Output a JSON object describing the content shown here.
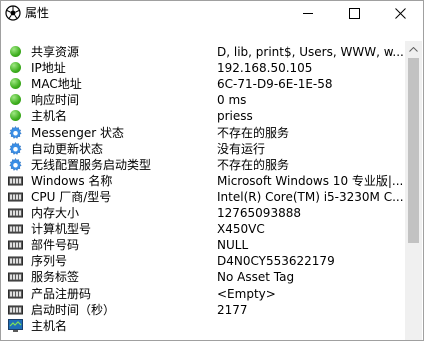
{
  "window": {
    "title": "属性"
  },
  "rows": [
    {
      "label": "共享资源",
      "value": "D, lib, print$, Users, WWW, w...",
      "icon": "green-dot-icon"
    },
    {
      "label": "IP地址",
      "value": "192.168.50.105",
      "icon": "green-dot-icon"
    },
    {
      "label": "MAC地址",
      "value": "6C-71-D9-6E-1E-58",
      "icon": "green-dot-icon"
    },
    {
      "label": "响应时间",
      "value": "0 ms",
      "icon": "green-dot-icon"
    },
    {
      "label": "主机名",
      "value": "priess",
      "icon": "green-dot-icon"
    },
    {
      "label": "Messenger 状态",
      "value": "不存在的服务",
      "icon": "gear-icon"
    },
    {
      "label": "自动更新状态",
      "value": "没有运行",
      "icon": "gear-icon"
    },
    {
      "label": "无线配置服务启动类型",
      "value": "不存在的服务",
      "icon": "gear-icon"
    },
    {
      "label": "Windows 名称",
      "value": "Microsoft Windows 10 专业版|...",
      "icon": "memory-chip-icon"
    },
    {
      "label": "CPU 厂商/型号",
      "value": "Intel(R) Core(TM) i5-3230M C...",
      "icon": "memory-chip-icon"
    },
    {
      "label": "内存大小",
      "value": "12765093888",
      "icon": "memory-chip-icon"
    },
    {
      "label": "计算机型号",
      "value": "X450VC",
      "icon": "memory-chip-icon"
    },
    {
      "label": "部件号码",
      "value": "NULL",
      "icon": "memory-chip-icon"
    },
    {
      "label": "序列号",
      "value": "D4N0CY553622179",
      "icon": "memory-chip-icon"
    },
    {
      "label": "服务标签",
      "value": "No Asset Tag",
      "icon": "memory-chip-icon"
    },
    {
      "label": "产品注册码",
      "value": "<Empty>",
      "icon": "memory-chip-icon"
    },
    {
      "label": "启动时间（秒）",
      "value": "2177",
      "icon": "memory-chip-icon"
    },
    {
      "label": "主机名",
      "value": "",
      "icon": "monitor-icon"
    }
  ],
  "colors": {
    "dot_green": "#3eae1e",
    "scrollbar_thumb": "#c2c2c2"
  }
}
